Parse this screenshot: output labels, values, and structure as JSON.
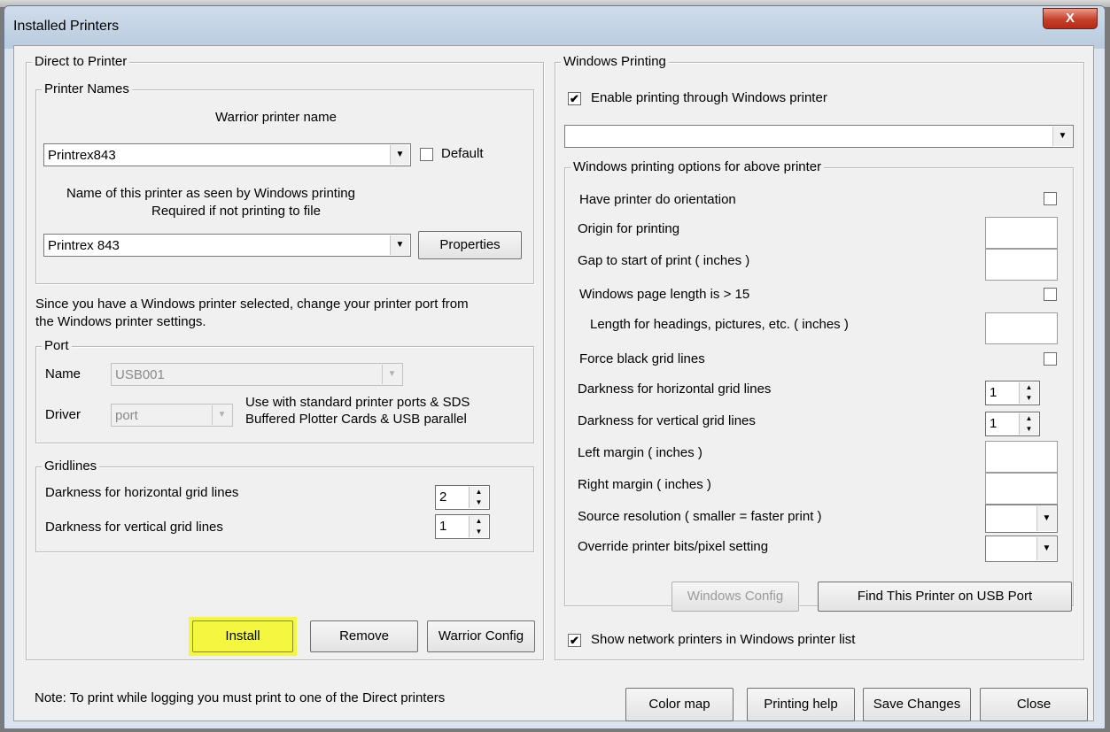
{
  "window": {
    "title": "Installed Printers",
    "close_glyph": "X"
  },
  "direct": {
    "legend": "Direct to Printer",
    "printer_names": {
      "legend": "Printer Names",
      "warrior_label": "Warrior printer name",
      "warrior_value": "Printrex843",
      "default_label": "Default",
      "default_checked": false,
      "windows_label_1": "Name of this printer as seen by Windows printing",
      "windows_label_2": "Required if not printing to file",
      "windows_value": "Printrex 843",
      "properties_label": "Properties"
    },
    "info_line_1": "Since you have a Windows printer selected, change your printer port from",
    "info_line_2": "the Windows printer settings.",
    "port": {
      "legend": "Port",
      "name_label": "Name",
      "name_value": "USB001",
      "driver_label": "Driver",
      "driver_value": "port",
      "note_1": "Use with standard printer ports & SDS",
      "note_2": "Buffered Plotter Cards & USB parallel"
    },
    "gridlines": {
      "legend": "Gridlines",
      "horizontal_label": "Darkness for horizontal grid lines",
      "horizontal_value": "2",
      "vertical_label": "Darkness for vertical grid lines",
      "vertical_value": "1"
    },
    "buttons": {
      "install": "Install",
      "remove": "Remove",
      "warrior_config": "Warrior Config"
    }
  },
  "windows": {
    "legend": "Windows Printing",
    "enable_label": "Enable printing through Windows printer",
    "enable_checked": true,
    "printer_select_value": "",
    "options": {
      "legend": "Windows printing options for above printer",
      "orientation_label": "Have printer do orientation",
      "origin_label": "Origin for printing",
      "gap_label": "Gap to start of print ( inches )",
      "page_length_label": "Windows page length is > 15",
      "length_headings_label": "Length for headings, pictures, etc. ( inches )",
      "force_black_label": "Force black grid lines",
      "dark_h_label": "Darkness for horizontal grid lines",
      "dark_h_value": "1",
      "dark_v_label": "Darkness for vertical grid lines",
      "dark_v_value": "1",
      "left_margin_label": "Left margin ( inches )",
      "right_margin_label": "Right margin ( inches )",
      "source_res_label": "Source resolution ( smaller = faster print )",
      "override_bits_label": "Override printer bits/pixel setting",
      "windows_config_label": "Windows Config",
      "find_usb_label": "Find This Printer on USB Port"
    },
    "show_network_label": "Show network printers in Windows printer list",
    "show_network_checked": true
  },
  "footer": {
    "note": "Note: To print while logging you must print to one of the Direct printers",
    "color_map": "Color map",
    "printing_help": "Printing help",
    "save_changes": "Save Changes",
    "close": "Close"
  },
  "colors": {
    "install_highlight": "#f3f740",
    "close_button": "#c4402a"
  }
}
